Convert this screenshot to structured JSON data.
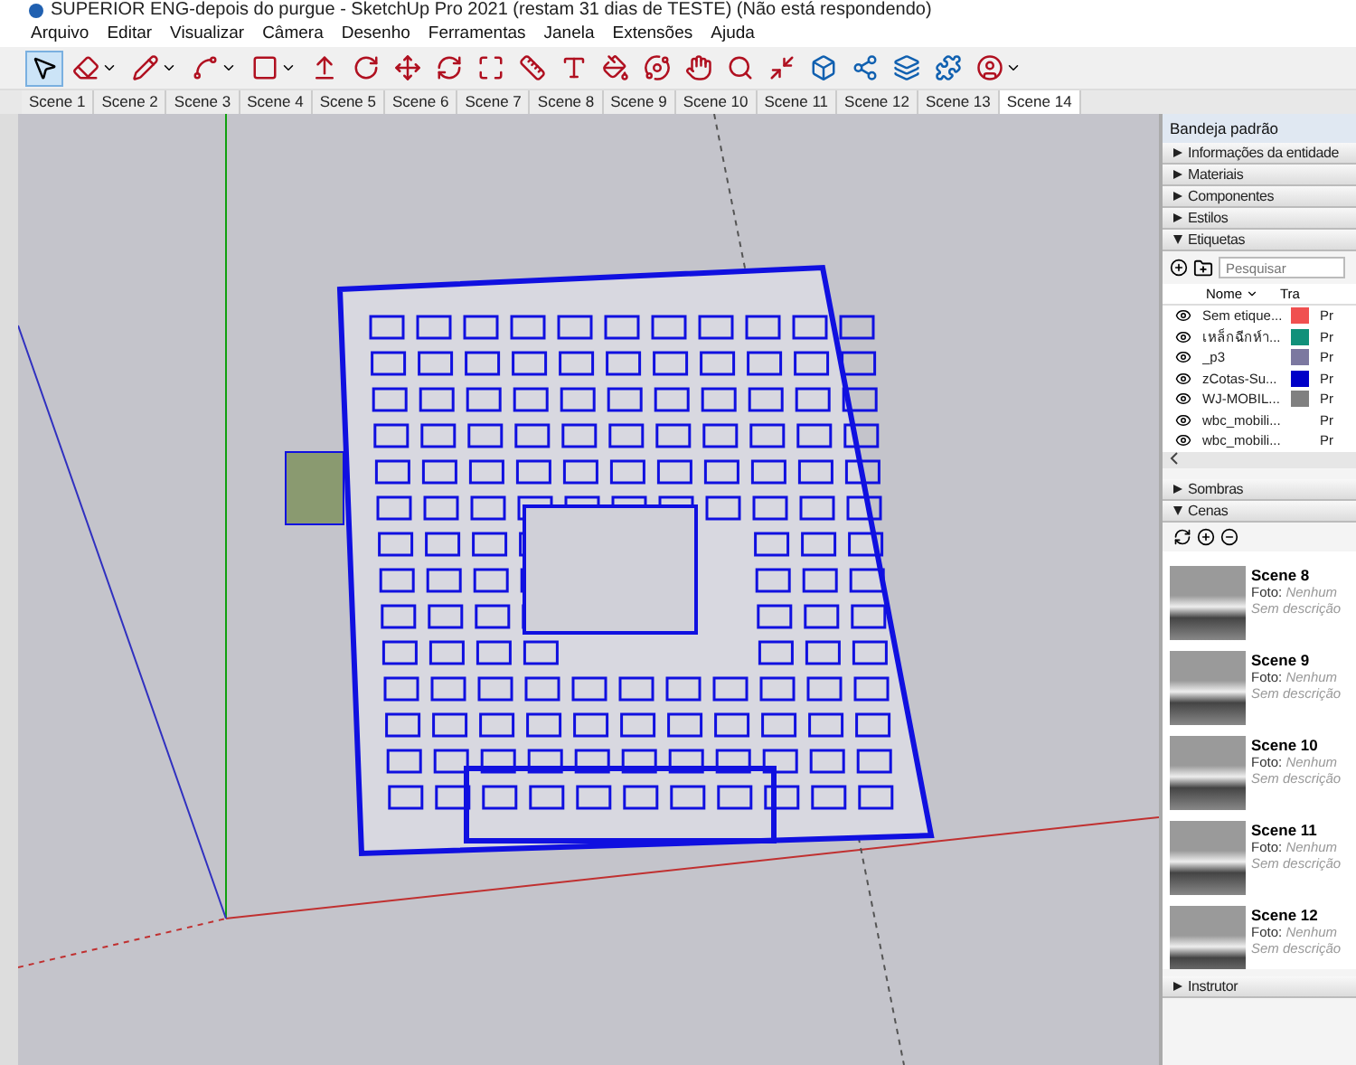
{
  "window": {
    "title": "SUPERIOR ENG-depois do purgue - SketchUp Pro 2021 (restam 31 dias de TESTE) (Não está respondendo)"
  },
  "menu": [
    "Arquivo",
    "Editar",
    "Visualizar",
    "Câmera",
    "Desenho",
    "Ferramentas",
    "Janela",
    "Extensões",
    "Ajuda"
  ],
  "tools": [
    {
      "kind": "select",
      "selected": true
    },
    {
      "kind": "eraser",
      "selected": false
    },
    {
      "kind": "pencil",
      "selected": false
    },
    {
      "kind": "arc",
      "selected": false
    },
    {
      "kind": "rectangle",
      "selected": false
    },
    {
      "kind": "pushpull",
      "selected": false
    },
    {
      "kind": "followme",
      "selected": false
    },
    {
      "kind": "move",
      "selected": false
    },
    {
      "kind": "rotate",
      "selected": false
    },
    {
      "kind": "scale",
      "selected": false
    },
    {
      "kind": "tape",
      "selected": false
    },
    {
      "kind": "text",
      "selected": false
    },
    {
      "kind": "paint",
      "selected": false
    },
    {
      "kind": "orbit",
      "selected": false
    },
    {
      "kind": "pan",
      "selected": false
    },
    {
      "kind": "zoom",
      "selected": false
    },
    {
      "kind": "extents",
      "selected": false
    },
    {
      "kind": "warehouse",
      "selected": false
    },
    {
      "kind": "share",
      "selected": false
    },
    {
      "kind": "layers",
      "selected": false
    },
    {
      "kind": "extension",
      "selected": false
    },
    {
      "kind": "profile",
      "selected": false
    }
  ],
  "scene_tabs": [
    {
      "label": "Scene 1",
      "selected": false
    },
    {
      "label": "Scene 2",
      "selected": false
    },
    {
      "label": "Scene 3",
      "selected": false
    },
    {
      "label": "Scene 4",
      "selected": false
    },
    {
      "label": "Scene 5",
      "selected": false
    },
    {
      "label": "Scene 6",
      "selected": false
    },
    {
      "label": "Scene 7",
      "selected": false
    },
    {
      "label": "Scene 8",
      "selected": false
    },
    {
      "label": "Scene 9",
      "selected": false
    },
    {
      "label": "Scene 10",
      "selected": false
    },
    {
      "label": "Scene 11",
      "selected": false
    },
    {
      "label": "Scene 12",
      "selected": false
    },
    {
      "label": "Scene 13",
      "selected": false
    },
    {
      "label": "Scene 14",
      "selected": true
    }
  ],
  "tray": {
    "title": "Bandeja padrão",
    "sections_top": [
      {
        "label": "Informações da entidade",
        "expanded": false
      },
      {
        "label": "Materiais",
        "expanded": false
      },
      {
        "label": "Componentes",
        "expanded": false
      },
      {
        "label": "Estilos",
        "expanded": false
      },
      {
        "label": "Etiquetas",
        "expanded": true
      }
    ],
    "tags": {
      "search_placeholder": "Pesquisar",
      "columns": [
        "Nome",
        "Tra"
      ],
      "rows": [
        {
          "name": "Sem etique...",
          "color": "#f05050",
          "column_3": "Pr"
        },
        {
          "name": "เหล็กฉีกห์า...",
          "color": "#10907a",
          "column_3": "Pr"
        },
        {
          "name": "_p3",
          "color": "#7c78a0",
          "column_3": "Pr"
        },
        {
          "name": "zCotas-Su...",
          "color": "#0000c8",
          "column_3": "Pr"
        },
        {
          "name": "WJ-MOBIL...",
          "color": "#808080",
          "column_3": "Pr"
        },
        {
          "name": "wbc_mobili...",
          "column_3": "Pr"
        },
        {
          "name": "wbc_mobili...",
          "column_3": "Pr"
        }
      ]
    },
    "sections_mid": [
      {
        "label": "Sombras",
        "expanded": false
      },
      {
        "label": "Cenas",
        "expanded": true
      }
    ],
    "scenes": [
      {
        "name": "Scene 8",
        "photo_label": "Foto:",
        "photo": "Nenhum",
        "description": "Sem descrição"
      },
      {
        "name": "Scene 9",
        "photo_label": "Foto:",
        "photo": "Nenhum",
        "description": "Sem descrição"
      },
      {
        "name": "Scene 10",
        "photo_label": "Foto:",
        "photo": "Nenhum",
        "description": "Sem descrição"
      },
      {
        "name": "Scene 11",
        "photo_label": "Foto:",
        "photo": "Nenhum",
        "description": "Sem descrição"
      },
      {
        "name": "Scene 12",
        "photo_label": "Foto:",
        "photo": "Nenhum",
        "description": "Sem descrição"
      }
    ],
    "sections_bottom": [
      {
        "label": "Instrutor",
        "expanded": false
      }
    ]
  }
}
